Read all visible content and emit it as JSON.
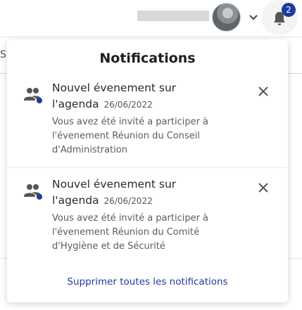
{
  "header": {
    "notification_count": "2",
    "icons": [
      "avatar",
      "chevron-down-icon",
      "bell-icon"
    ]
  },
  "background": {
    "partial_letter": "S"
  },
  "panel": {
    "title": "Notifications",
    "notifications": [
      {
        "title_line1": "Nouvel évenement sur",
        "title_line2": "l'agenda",
        "date": "26/06/2022",
        "body": "Vous avez été invité a participer à l'évenement Réunion du Conseil d'Administration"
      },
      {
        "title_line1": "Nouvel évenement sur",
        "title_line2": "l'agenda",
        "date": "26/06/2022",
        "body": "Vous avez été invité a participer à l'évenement Réunion du Comité d'Hygiène et de Sécurité"
      }
    ],
    "clear_all_label": "Supprimer toutes les notifications"
  },
  "colors": {
    "accent": "#1f3a9e",
    "badge": "#1f3a9e"
  }
}
